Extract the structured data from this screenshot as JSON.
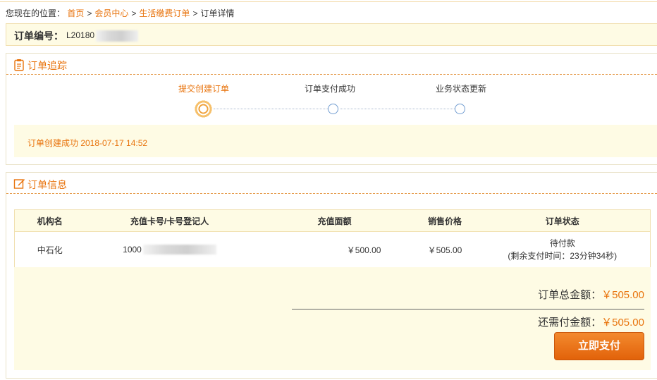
{
  "breadcrumb": {
    "prefix": "您现在的位置：",
    "sep": ">",
    "items": [
      "首页",
      "会员中心",
      "生活缴费订单",
      "订单详情"
    ]
  },
  "order": {
    "label": "订单编号：",
    "number": "L20180"
  },
  "tracking": {
    "title": "订单追踪",
    "steps": [
      {
        "label": "提交创建订单",
        "active": true
      },
      {
        "label": "订单支付成功",
        "active": false
      },
      {
        "label": "业务状态更新",
        "active": false
      }
    ],
    "message": "订单创建成功  2018-07-17 14:52"
  },
  "info": {
    "title": "订单信息",
    "columns": [
      "机构名",
      "充值卡号/卡号登记人",
      "充值面额",
      "销售价格",
      "订单状态"
    ],
    "row": {
      "org": "中石化",
      "card": "1000",
      "face_value": "￥500.00",
      "price": "￥505.00",
      "status": "待付款",
      "status_note": "(剩余支付时间：23分钟34秒)"
    },
    "total_label": "订单总金额：",
    "total_amount": "￥505.00",
    "due_label": "还需付金额：",
    "due_amount": "￥505.00",
    "pay_button": "立即支付"
  },
  "colors": {
    "accent": "#e8730c",
    "panel_bg": "#fefbe4",
    "button": "#ee7a1e"
  }
}
